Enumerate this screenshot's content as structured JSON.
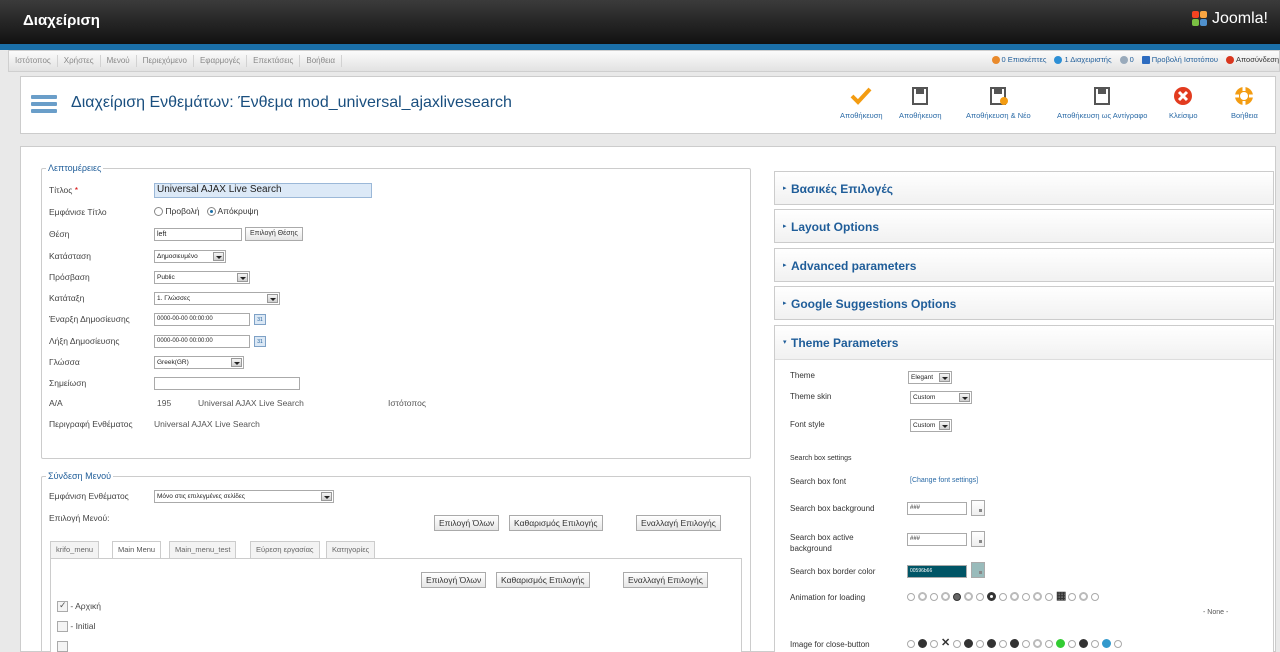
{
  "header": {
    "title": "Διαχείριση",
    "logo_text": "Joomla!"
  },
  "menu": {
    "items": [
      "Ιστότοπος",
      "Χρήστες",
      "Μενού",
      "Περιεχόμενο",
      "Εφαρμογές",
      "Επεκτάσεις",
      "Βοήθεια"
    ]
  },
  "status": {
    "visitors": "0 Επισκέπτες",
    "admins": "1 Διαχειριστής",
    "messages": "0",
    "view_site": "Προβολή Ιστοτόπου",
    "logout": "Αποσύνδεση"
  },
  "toolbar": {
    "page_title": "Διαχείριση Ενθεμάτων: Ένθεμα mod_universal_ajaxlivesearch",
    "buttons": [
      "Αποθήκευση",
      "Αποθήκευση",
      "Αποθήκευση & Νέο",
      "Αποθήκευση ως Αντίγραφο",
      "Κλείσιμο",
      "Βοήθεια"
    ]
  },
  "details": {
    "legend": "Λεπτομέρειες",
    "title_label": "Τίτλος",
    "title_required": "*",
    "title_value": "Universal AJAX Live Search",
    "show_title_label": "Εμφάνισε Τίτλο",
    "show_option": "Προβολή",
    "hide_option": "Απόκρυψη",
    "position_label": "Θέση",
    "position_value": "left",
    "position_button": "Επιλογή Θέσης",
    "status_label": "Κατάσταση",
    "status_value": "Δημοσιευμένο",
    "access_label": "Πρόσβαση",
    "access_value": "Public",
    "ordering_label": "Κατάταξη",
    "ordering_value": "1. Γλώσσες",
    "publish_up_label": "Έναρξη Δημοσίευσης",
    "publish_up_value": "0000-00-00 00:00:00",
    "publish_down_label": "Λήξη Δημοσίευσης",
    "publish_down_value": "0000-00-00 00:00:00",
    "calendar_label": "31",
    "language_label": "Γλώσσα",
    "language_value": "Greek(GR)",
    "note_label": "Σημείωση",
    "note_value": "",
    "id_label": "Α/Α",
    "id_value": "195",
    "id_name": "Universal AJAX Live Search",
    "id_site": "Ιστότοπος",
    "desc_label": "Περιγραφή Ενθέματος",
    "desc_value": "Universal AJAX Live Search"
  },
  "menu_assign": {
    "legend": "Σύνδεση Μενού",
    "show_label": "Εμφάνιση Ενθέματος",
    "show_value": "Μόνο στις επιλεγμένες σελίδες",
    "select_label": "Επιλογή Μενού:",
    "btn_all": "Επιλογή Όλων",
    "btn_clear": "Καθαρισμός Επιλογής",
    "btn_toggle": "Εναλλαγή Επιλογής",
    "tabs": [
      "krifo_menu",
      "Main Menu",
      "Main_menu_test",
      "Εύρεση εργασίας",
      "Κατηγορίες"
    ],
    "items": [
      "- Αρχική",
      "- Initial"
    ]
  },
  "panels": {
    "basic": "Βασικές Επιλογές",
    "layout": "Layout Options",
    "advanced": "Advanced parameters",
    "google": "Google Suggestions Options",
    "theme": "Theme Parameters"
  },
  "theme": {
    "theme_label": "Theme",
    "theme_value": "Elegant",
    "skin_label": "Theme skin",
    "skin_value": "Custom",
    "font_style_label": "Font style",
    "font_style_value": "Custom",
    "search_box_settings": "Search box settings",
    "box_font_label": "Search box font",
    "box_font_link": "[Change font settings]",
    "bg_label": "Search box background",
    "bg_value": "###",
    "active_bg_label": "Search box active background",
    "active_bg_value": "###",
    "border_label": "Search box border color",
    "border_value": "00596b66",
    "border_color": "#005566",
    "anim_label": "Animation for loading",
    "anim_none": "- None -",
    "close_label": "Image for close-button"
  }
}
